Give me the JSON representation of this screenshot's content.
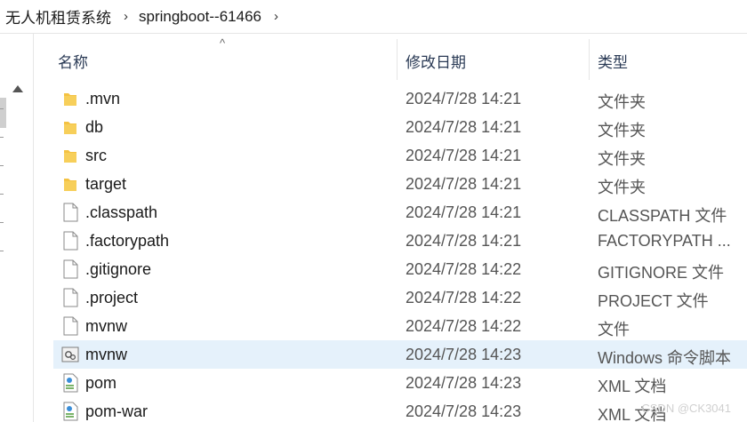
{
  "breadcrumb": {
    "items": [
      "无人机租赁系统",
      "springboot--61466"
    ],
    "separator": "›"
  },
  "columns": {
    "name": "名称",
    "date": "修改日期",
    "type": "类型",
    "sort_indicator": "^"
  },
  "files": [
    {
      "name": ".mvn",
      "date": "2024/7/28 14:21",
      "type": "文件夹",
      "icon": "folder-icon"
    },
    {
      "name": "db",
      "date": "2024/7/28 14:21",
      "type": "文件夹",
      "icon": "folder-icon"
    },
    {
      "name": "src",
      "date": "2024/7/28 14:21",
      "type": "文件夹",
      "icon": "folder-icon"
    },
    {
      "name": "target",
      "date": "2024/7/28 14:21",
      "type": "文件夹",
      "icon": "folder-icon"
    },
    {
      "name": ".classpath",
      "date": "2024/7/28 14:21",
      "type": "CLASSPATH 文件",
      "icon": "file-icon"
    },
    {
      "name": ".factorypath",
      "date": "2024/7/28 14:21",
      "type": "FACTORYPATH ...",
      "icon": "file-icon"
    },
    {
      "name": ".gitignore",
      "date": "2024/7/28 14:22",
      "type": "GITIGNORE 文件",
      "icon": "file-icon"
    },
    {
      "name": ".project",
      "date": "2024/7/28 14:22",
      "type": "PROJECT 文件",
      "icon": "file-icon"
    },
    {
      "name": "mvnw",
      "date": "2024/7/28 14:22",
      "type": "文件",
      "icon": "file-icon"
    },
    {
      "name": "mvnw",
      "date": "2024/7/28 14:23",
      "type": "Windows 命令脚本",
      "icon": "script-icon",
      "selected": true
    },
    {
      "name": "pom",
      "date": "2024/7/28 14:23",
      "type": "XML 文档",
      "icon": "xml-icon"
    },
    {
      "name": "pom-war",
      "date": "2024/7/28 14:23",
      "type": "XML 文档",
      "icon": "xml-icon"
    }
  ],
  "watermark": "CSDN @CK3041",
  "colors": {
    "selection": "#e5f1fb",
    "folder": "#f4c242",
    "header_text": "#2a3a55"
  }
}
